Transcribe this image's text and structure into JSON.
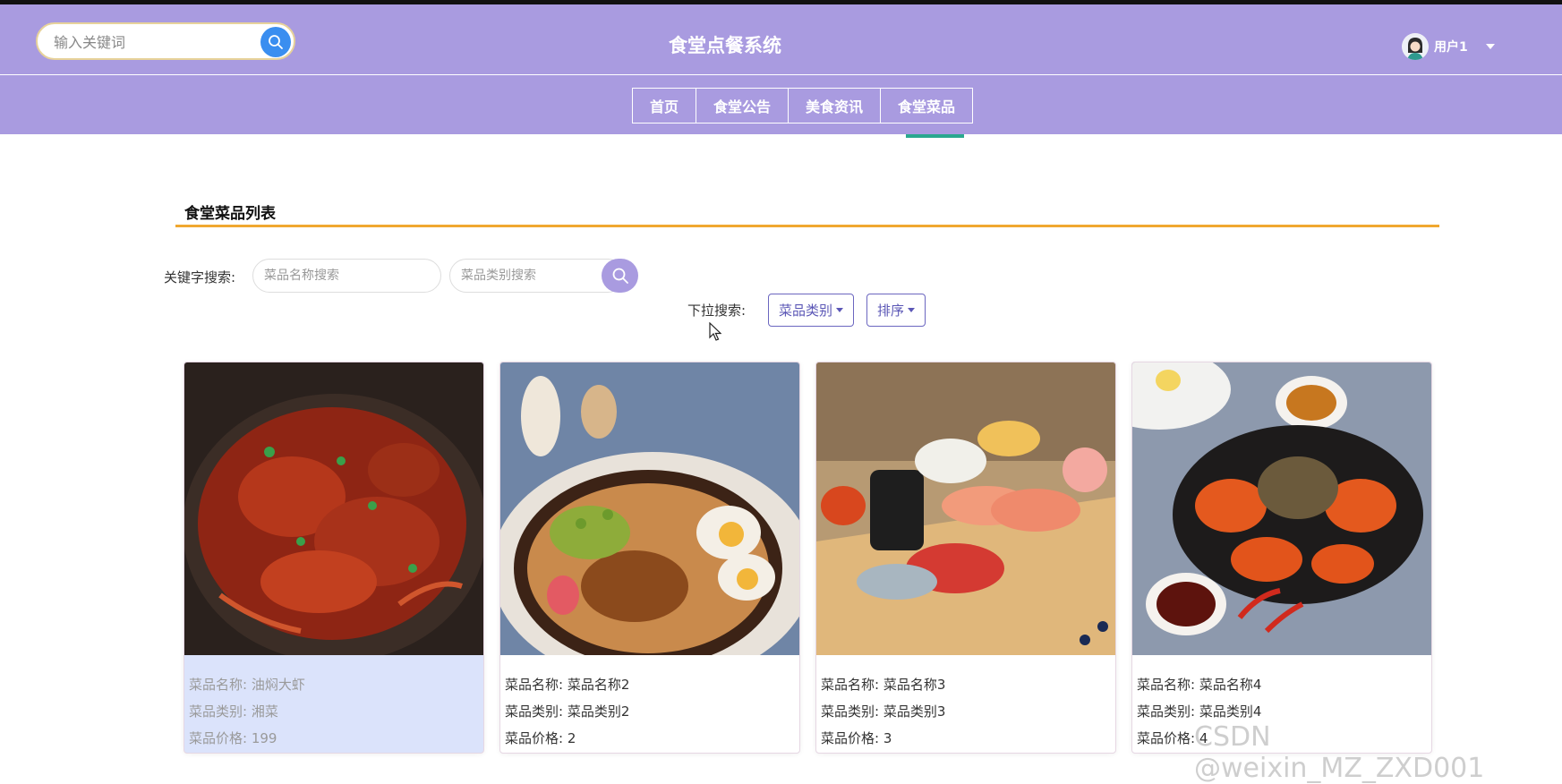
{
  "header": {
    "search_placeholder": "输入关键词",
    "site_title": "食堂点餐系统",
    "user_name": "用户1"
  },
  "nav": {
    "items": [
      {
        "label": "首页"
      },
      {
        "label": "食堂公告"
      },
      {
        "label": "美食资讯"
      },
      {
        "label": "食堂菜品"
      }
    ],
    "active": "食堂菜品"
  },
  "section": {
    "title": "食堂菜品列表"
  },
  "filters": {
    "keyword_label": "关键字搜索:",
    "name_placeholder": "菜品名称搜索",
    "category_placeholder": "菜品类别搜索",
    "dropdown_label": "下拉搜索:",
    "category_dropdown": "菜品类别",
    "sort_dropdown": "排序"
  },
  "dishes": [
    {
      "name_row": "菜品名称: 油焖大虾",
      "category_row": "菜品类别: 湘菜",
      "price_row": "菜品价格: 199",
      "image": "crayfish-dish"
    },
    {
      "name_row": "菜品名称: 菜品名称2",
      "category_row": "菜品类别: 菜品类别2",
      "price_row": "菜品价格: 2",
      "image": "rice-bowl-with-eggs"
    },
    {
      "name_row": "菜品名称: 菜品名称3",
      "category_row": "菜品类别: 菜品类别3",
      "price_row": "菜品价格: 3",
      "image": "sushi-platter"
    },
    {
      "name_row": "菜品名称: 菜品名称4",
      "category_row": "菜品类别: 菜品类别4",
      "price_row": "菜品价格: 4",
      "image": "crab-dish"
    }
  ],
  "watermark": "CSDN @weixin_MZ_ZXD001",
  "colors": {
    "header_bg": "#a99be0",
    "search_button": "#3a8ef0",
    "section_underline": "#f0a830",
    "active_nav_indicator": "#2aa88f",
    "hover_card_bg": "#dbe3fb"
  }
}
